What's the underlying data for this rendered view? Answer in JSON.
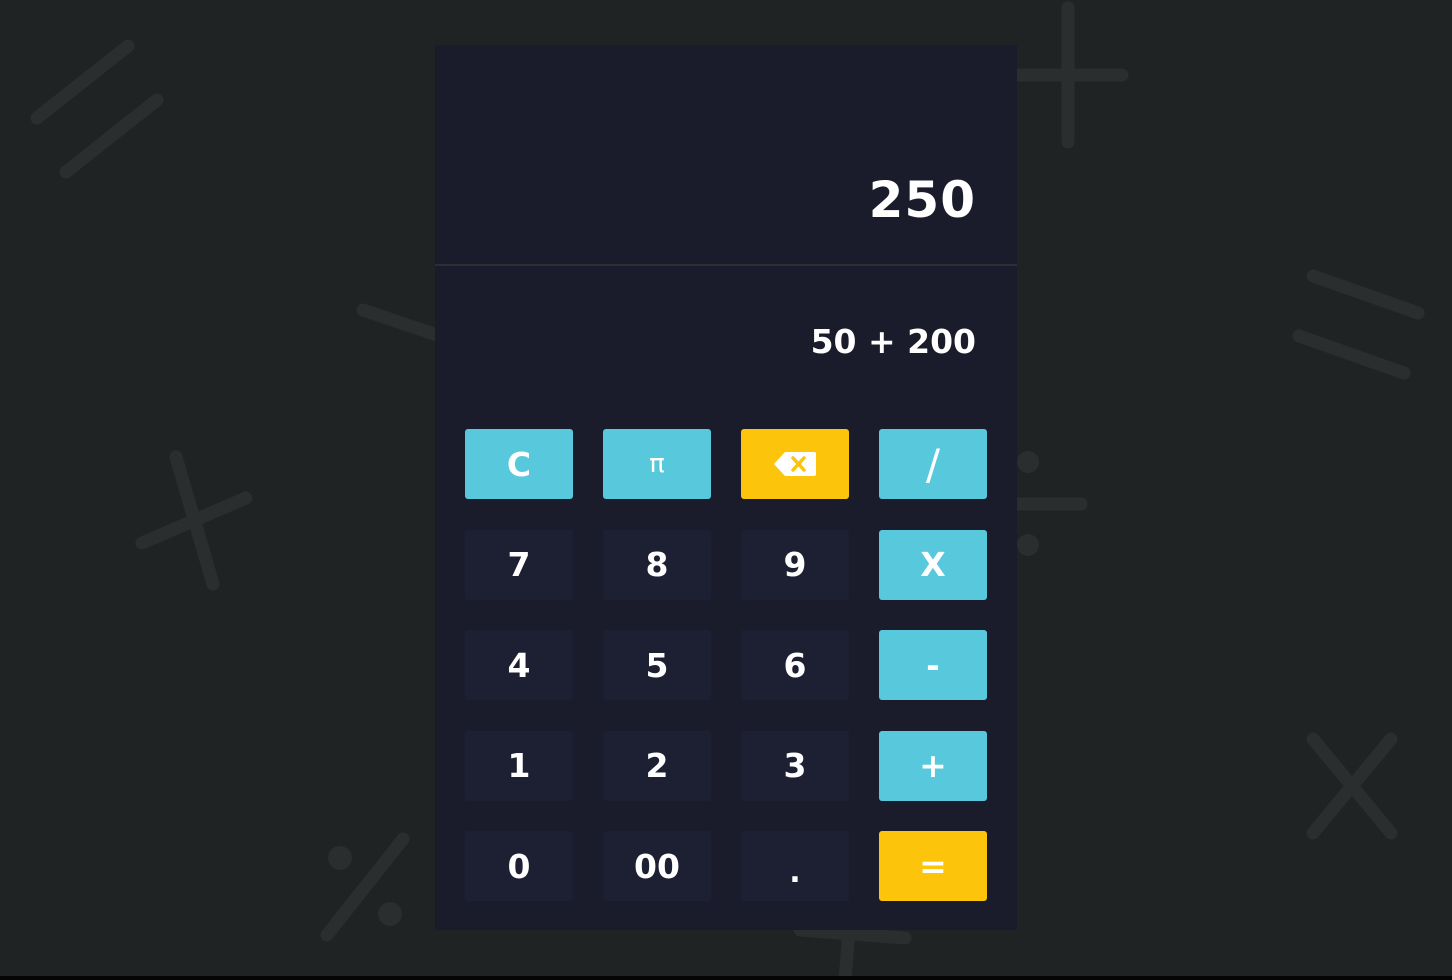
{
  "display": {
    "result": "250",
    "expression": "50 + 200"
  },
  "keys": {
    "clear": "C",
    "pi": "π",
    "backspace_icon": "backspace-icon",
    "divide": "/",
    "seven": "7",
    "eight": "8",
    "nine": "9",
    "multiply": "X",
    "four": "4",
    "five": "5",
    "six": "6",
    "subtract": "-",
    "one": "1",
    "two": "2",
    "three": "3",
    "add": "+",
    "zero": "0",
    "double_zero": "00",
    "decimal": ".",
    "equals": "="
  },
  "colors": {
    "background": "#1f2324",
    "panel": "#1a1c2b",
    "number_key": "#1d2032",
    "operator_key": "#58c9dc",
    "accent_key": "#fcc40b"
  }
}
